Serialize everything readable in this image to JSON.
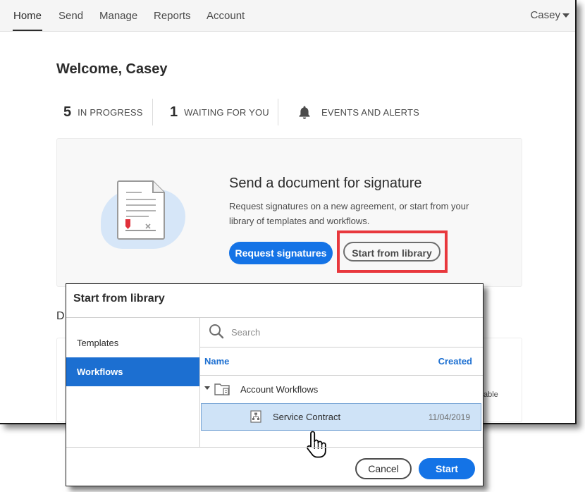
{
  "nav": {
    "items": [
      {
        "label": "Home",
        "active": true
      },
      {
        "label": "Send"
      },
      {
        "label": "Manage"
      },
      {
        "label": "Reports"
      },
      {
        "label": "Account"
      }
    ],
    "user": "Casey"
  },
  "welcome": "Welcome, Casey",
  "stats": {
    "in_progress": {
      "count": "5",
      "label": "IN PROGRESS"
    },
    "waiting": {
      "count": "1",
      "label": "WAITING FOR YOU"
    },
    "events": {
      "label": "EVENTS AND ALERTS",
      "icon": "bell-icon"
    }
  },
  "send_card": {
    "title": "Send a document for signature",
    "description": "Request signatures on a new agreement, or start from your library of templates and workflows.",
    "request_button": "Request signatures",
    "library_button": "Start from library"
  },
  "background_fragments": {
    "heading_fragment": "D",
    "card_fragment": "able"
  },
  "colors": {
    "accent": "#1473e6",
    "selected": "#1c6fd1",
    "highlight": "#e8383d",
    "row_selected": "#cfe3f7"
  },
  "dialog": {
    "title": "Start from library",
    "sidebar": [
      {
        "label": "Templates"
      },
      {
        "label": "Workflows",
        "selected": true
      }
    ],
    "search_placeholder": "Search",
    "columns": {
      "name": "Name",
      "created": "Created"
    },
    "folder": {
      "label": "Account Workflows",
      "icon": "folder-icon"
    },
    "items": [
      {
        "name": "Service Contract",
        "created": "11/04/2019",
        "icon": "workflow-icon",
        "selected": true
      }
    ],
    "cancel_button": "Cancel",
    "start_button": "Start"
  }
}
